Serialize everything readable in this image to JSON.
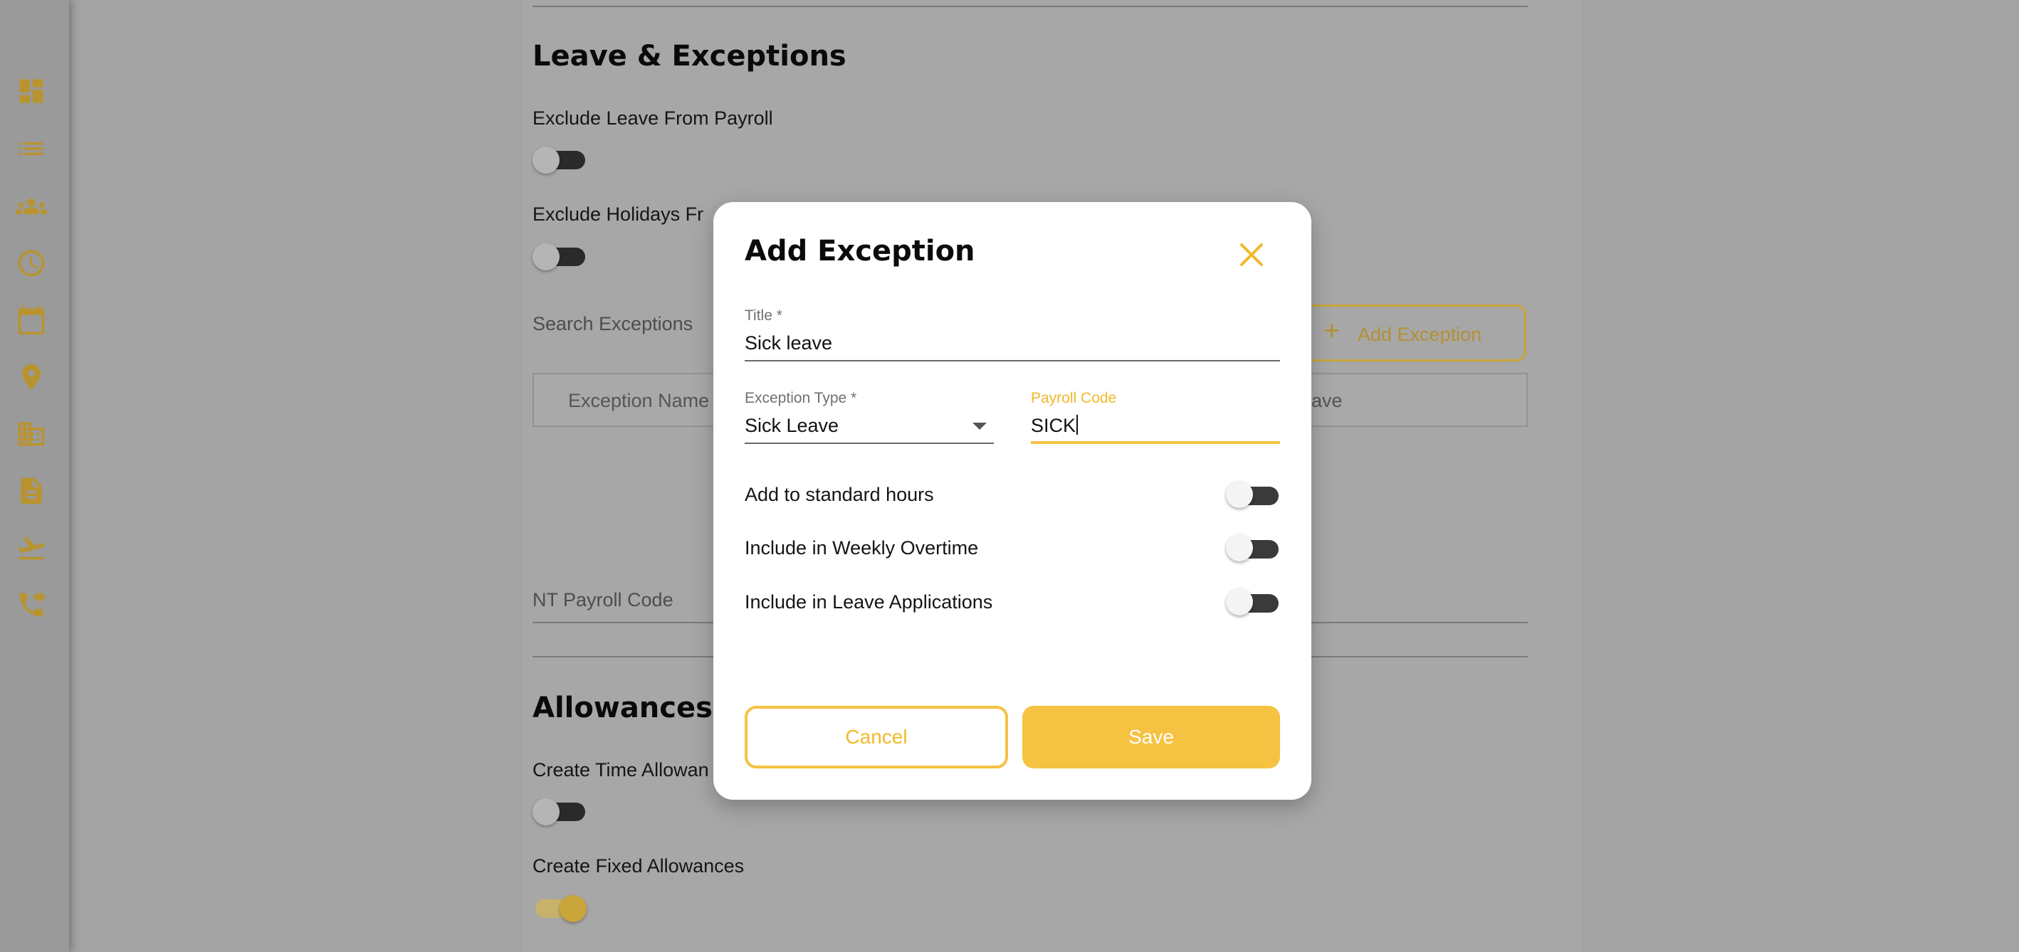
{
  "colors": {
    "accent": "#f5c242",
    "sidebar_icon": "#b8932f"
  },
  "sidebar": {
    "items": [
      {
        "icon": "dashboard-icon"
      },
      {
        "icon": "list-icon"
      },
      {
        "icon": "people-icon"
      },
      {
        "icon": "clock-icon"
      },
      {
        "icon": "calendar-icon"
      },
      {
        "icon": "location-pin-icon"
      },
      {
        "icon": "building-icon"
      },
      {
        "icon": "document-icon"
      },
      {
        "icon": "flight-departure-icon"
      },
      {
        "icon": "phone-forward-icon"
      }
    ]
  },
  "background": {
    "leave_section": {
      "title": "Leave & Exceptions",
      "exclude_leave_label": "Exclude Leave From Payroll",
      "exclude_holidays_label": "Exclude Holidays Fr",
      "search_placeholder": "Search Exceptions",
      "add_exception_button": "Add Exception",
      "table_col_name": "Exception Name",
      "table_col_leave": "Leave",
      "nt_payroll_code": "NT Payroll Code"
    },
    "allowances_section": {
      "title": "Allowances",
      "create_time_label": "Create Time Allowan",
      "create_fixed_label": "Create Fixed Allowances",
      "create_fixed_enabled": true
    }
  },
  "modal": {
    "title": "Add Exception",
    "title_field": {
      "label": "Title *",
      "value": "Sick leave"
    },
    "exception_type": {
      "label": "Exception Type *",
      "value": "Sick Leave"
    },
    "payroll_code": {
      "label": "Payroll Code",
      "value": "SICK"
    },
    "options": [
      {
        "label": "Add to standard hours",
        "enabled": false
      },
      {
        "label": "Include in Weekly Overtime",
        "enabled": false
      },
      {
        "label": "Include in Leave Applications",
        "enabled": false
      }
    ],
    "cancel_label": "Cancel",
    "save_label": "Save"
  }
}
